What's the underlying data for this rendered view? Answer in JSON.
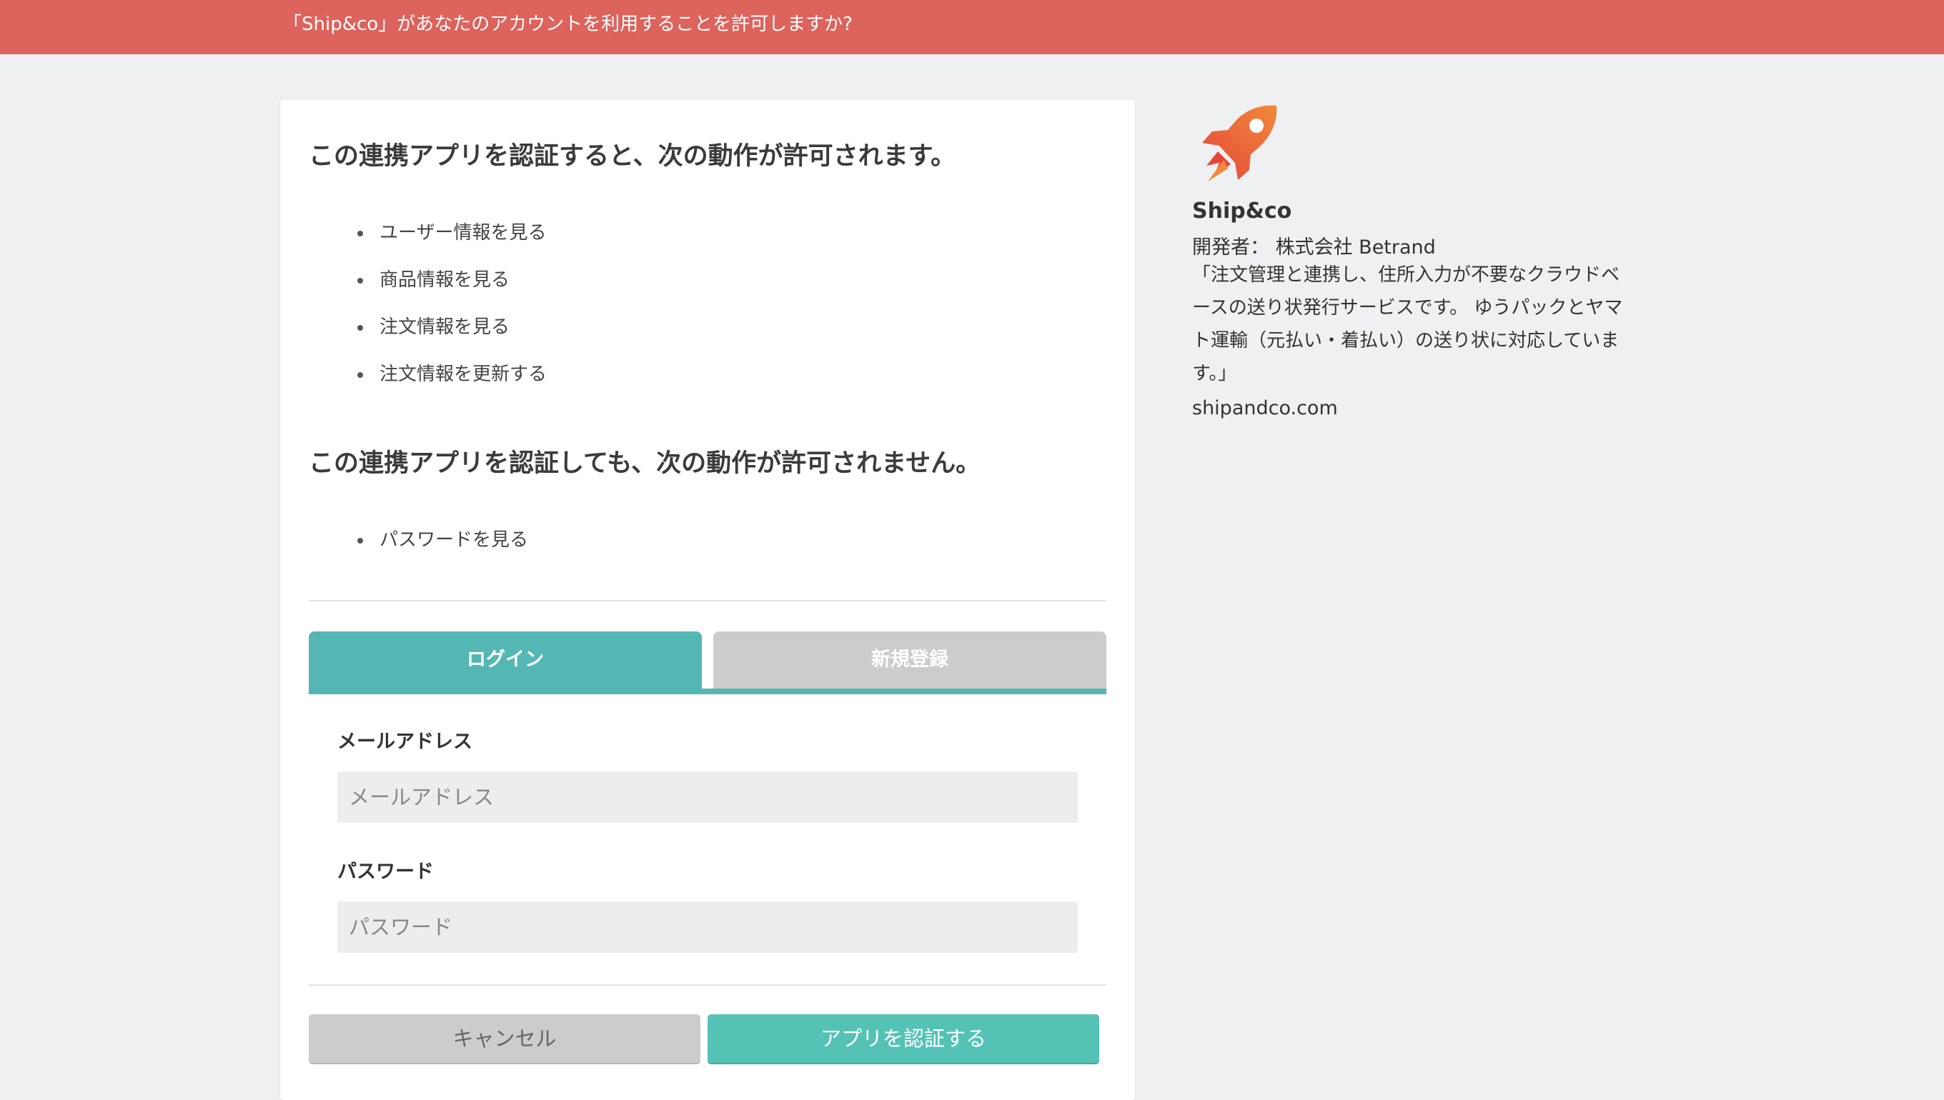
{
  "header": {
    "title": "「Ship&co」があなたのアカウントを利用することを許可しますか?"
  },
  "permissions": {
    "allowed_heading": "この連携アプリを認証すると、次の動作が許可されます。",
    "allowed_items": [
      "ユーザー情報を見る",
      "商品情報を見る",
      "注文情報を見る",
      "注文情報を更新する"
    ],
    "denied_heading": "この連携アプリを認証しても、次の動作が許可されません。",
    "denied_items": [
      "パスワードを見る"
    ]
  },
  "tabs": {
    "login": "ログイン",
    "register": "新規登録"
  },
  "form": {
    "email_label": "メールアドレス",
    "email_placeholder": "メールアドレス",
    "email_value": "",
    "password_label": "パスワード",
    "password_placeholder": "パスワード",
    "password_value": ""
  },
  "buttons": {
    "cancel": "キャンセル",
    "authorize": "アプリを認証する"
  },
  "app": {
    "logo_icon": "rocket-icon",
    "name": "Ship&co",
    "developer": "開発者： 株式会社 Betrand",
    "description": "「注文管理と連携し、住所入力が不要なクラウドベースの送り状発行サービスです。 ゆうパックとヤマト運輸（元払い・着払い）の送り状に対応しています。」",
    "url": "shipandco.com"
  },
  "colors": {
    "header_bar": "#dd635d",
    "tab_active": "#55b7b4",
    "tab_inactive": "#cccccc",
    "authorize_button": "#55c2b6",
    "cancel_button": "#cccccc",
    "page_background": "#eff0f2"
  }
}
